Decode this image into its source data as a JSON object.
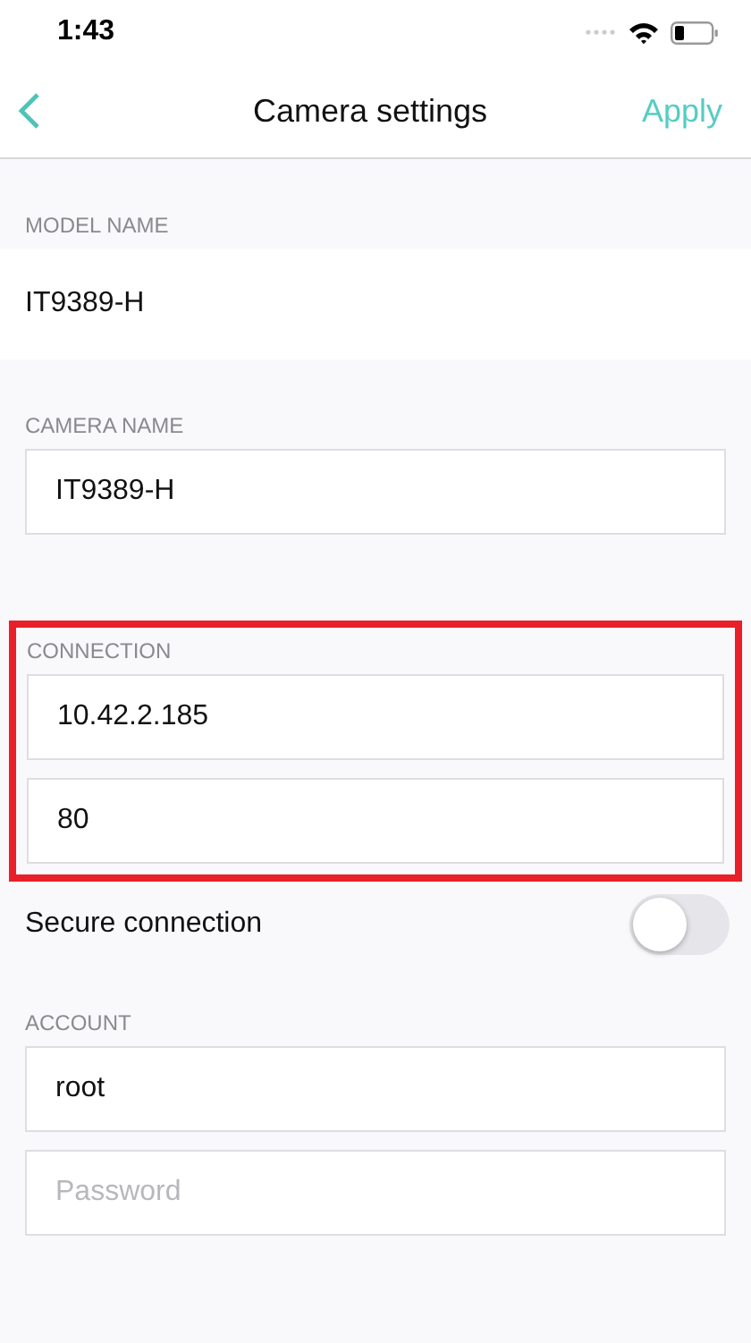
{
  "status_bar": {
    "time": "1:43"
  },
  "nav": {
    "title": "Camera settings",
    "action": "Apply"
  },
  "sections": [
    {
      "kind": "static",
      "label": "MODEL NAME",
      "value": "IT9389-H"
    },
    {
      "kind": "fields",
      "label": "CAMERA NAME",
      "highlighted": false,
      "fields": [
        {
          "value": "IT9389-H"
        }
      ]
    },
    {
      "kind": "fields",
      "label": "CONNECTION",
      "highlighted": true,
      "fields": [
        {
          "value": "10.42.2.185"
        },
        {
          "value": "80"
        }
      ]
    },
    {
      "kind": "toggle",
      "label": "Secure connection",
      "on": false
    },
    {
      "kind": "fields",
      "label": "ACCOUNT",
      "highlighted": false,
      "fields": [
        {
          "value": "root"
        },
        {
          "placeholder": "Password"
        }
      ]
    }
  ]
}
